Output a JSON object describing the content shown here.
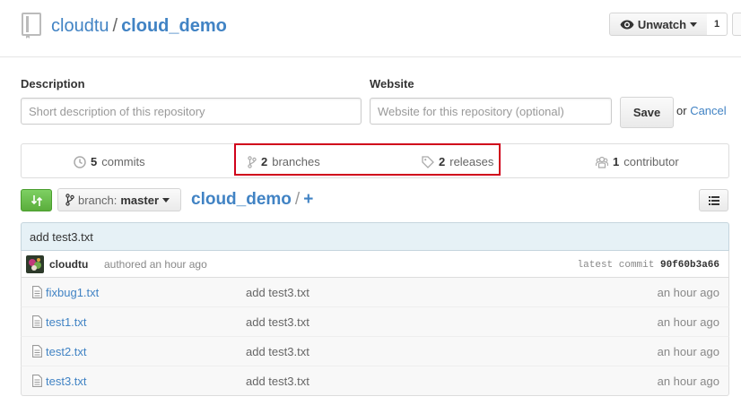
{
  "header": {
    "owner": "cloudtu",
    "separator": "/",
    "repo": "cloud_demo",
    "watch_label": "Unwatch",
    "watch_count": "1"
  },
  "repo_meta": {
    "description_label": "Description",
    "description_placeholder": "Short description of this repository",
    "website_label": "Website",
    "website_placeholder": "Website for this repository (optional)",
    "save_label": "Save",
    "or_text": "or",
    "cancel_label": "Cancel"
  },
  "stats": {
    "commits_count": "5",
    "commits_label": "commits",
    "branches_count": "2",
    "branches_label": "branches",
    "releases_count": "2",
    "releases_label": "releases",
    "contributors_count": "1",
    "contributors_label": "contributor",
    "highlight_color": "#d0021b"
  },
  "toolbar": {
    "branch_prefix": "branch:",
    "branch_name": "master",
    "breadcrumb_repo": "cloud_demo",
    "breadcrumb_sep": "/",
    "breadcrumb_plus": "+"
  },
  "latest_commit": {
    "message": "add test3.txt",
    "author": "cloudtu",
    "authored_text": "authored an hour ago",
    "latest_label": "latest commit",
    "sha": "90f60b3a66"
  },
  "files": [
    {
      "name": "fixbug1.txt",
      "message": "add test3.txt",
      "age": "an hour ago"
    },
    {
      "name": "test1.txt",
      "message": "add test3.txt",
      "age": "an hour ago"
    },
    {
      "name": "test2.txt",
      "message": "add test3.txt",
      "age": "an hour ago"
    },
    {
      "name": "test3.txt",
      "message": "add test3.txt",
      "age": "an hour ago"
    }
  ],
  "colors": {
    "link": "#4183c4",
    "compare_green": "#6cc644",
    "commit_bar_bg": "#e6f1f6"
  }
}
